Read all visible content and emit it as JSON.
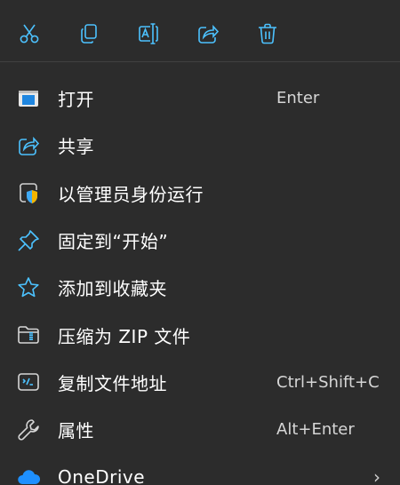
{
  "quick_actions": [
    {
      "name": "cut",
      "icon": "scissors-icon"
    },
    {
      "name": "copy",
      "icon": "copy-icon"
    },
    {
      "name": "rename",
      "icon": "rename-icon"
    },
    {
      "name": "share",
      "icon": "share-icon"
    },
    {
      "name": "delete",
      "icon": "trash-icon"
    }
  ],
  "menu": {
    "items": [
      {
        "label": "打开",
        "shortcut": "Enter",
        "icon": "open-window-icon"
      },
      {
        "label": "共享",
        "shortcut": "",
        "icon": "share-icon"
      },
      {
        "label": "以管理员身份运行",
        "shortcut": "",
        "icon": "shield-admin-icon"
      },
      {
        "label": "固定到“开始”",
        "shortcut": "",
        "icon": "pin-icon"
      },
      {
        "label": "添加到收藏夹",
        "shortcut": "",
        "icon": "star-icon"
      },
      {
        "label": "压缩为 ZIP 文件",
        "shortcut": "",
        "icon": "zip-folder-icon"
      },
      {
        "label": "复制文件地址",
        "shortcut": "Ctrl+Shift+C",
        "icon": "copy-path-icon"
      },
      {
        "label": "属性",
        "shortcut": "Alt+Enter",
        "icon": "wrench-icon"
      },
      {
        "label": "OneDrive",
        "shortcut": "",
        "icon": "onedrive-icon",
        "chevron": "›"
      }
    ]
  },
  "colors": {
    "background": "#2c2c2c",
    "accent": "#4cc2ff",
    "text": "#ffffff",
    "shortcut_text": "#d6d6d6"
  }
}
